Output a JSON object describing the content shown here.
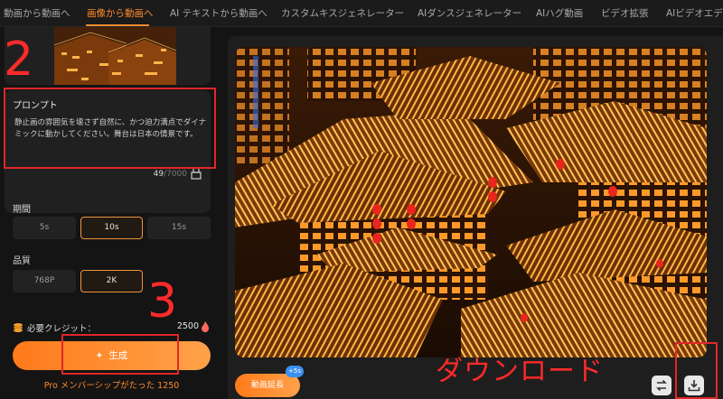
{
  "nav": {
    "tabs": [
      {
        "label": "動画から動画へ",
        "active": false
      },
      {
        "label": "画像から動画へ",
        "active": true
      },
      {
        "label": "AI テキストから動画へ",
        "active": false
      },
      {
        "label": "カスタムキスジェネレーター",
        "active": false
      },
      {
        "label": "AIダンスジェネレーター",
        "active": false
      },
      {
        "label": "AIハグ動画",
        "active": false
      },
      {
        "label": "ビデオ拡張",
        "active": false
      },
      {
        "label": "AIビデオエディ",
        "active": false
      }
    ]
  },
  "prompt": {
    "title": "プロンプト",
    "text": "静止画の雰囲気を壊さず自然に、かつ迫力満点でダイナミックに動かしてください。舞台は日本の情景です。",
    "count": "49",
    "max": "/7000"
  },
  "duration": {
    "label": "期間",
    "options": [
      {
        "label": "5s",
        "selected": false
      },
      {
        "label": "10s",
        "selected": true
      },
      {
        "label": "15s",
        "selected": false
      }
    ]
  },
  "quality": {
    "label": "品質",
    "options": [
      {
        "label": "768P",
        "selected": false
      },
      {
        "label": "2K",
        "selected": true
      }
    ]
  },
  "credits": {
    "label": "必要クレジット：",
    "value": "2500"
  },
  "generate": {
    "label": "生成"
  },
  "pro_text": "Pro メンバーシップがたった 1250",
  "extend": {
    "label": "動画延長",
    "badge": "+5s"
  },
  "annotations": {
    "step2": "2",
    "step3": "3",
    "download": "ダウンロード"
  },
  "icons": [
    "coin-icon",
    "flame-icon",
    "sparkle-icon",
    "clear-icon",
    "swap-icon",
    "download-icon"
  ],
  "colors": {
    "accent": "#ff8a2a",
    "annotation": "#ff2a2a",
    "badge": "#3b8ff0"
  }
}
